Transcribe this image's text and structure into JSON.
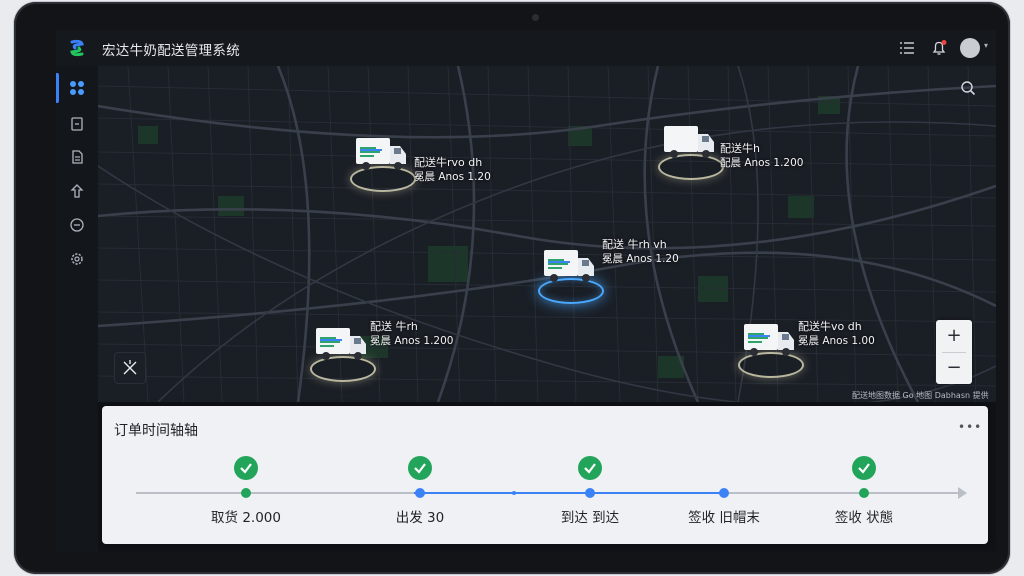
{
  "app": {
    "title": "宏达牛奶配送管理系统"
  },
  "colors": {
    "accent": "#3b82f6",
    "success": "#22a55a",
    "map_bg": "#1a1e25",
    "timeline_bg": "#f0f1f4"
  },
  "header_icons": [
    "list-icon",
    "notification-bell-icon",
    "user-avatar"
  ],
  "sidebar": {
    "items": [
      {
        "icon": "dashboard-icon",
        "active": true
      },
      {
        "icon": "orders-icon"
      },
      {
        "icon": "document-icon"
      },
      {
        "icon": "route-icon"
      },
      {
        "icon": "support-icon"
      },
      {
        "icon": "settings-icon"
      }
    ]
  },
  "map": {
    "credit": "配送地图数据 Go 地图 Dabhasn 提供",
    "zoom_in": "+",
    "zoom_out": "−",
    "trucks": [
      {
        "line1": "配送牛rvo dh",
        "line2": "冕晨 Anos 1.20",
        "active": false
      },
      {
        "line1": "配送牛h",
        "line2": "配晨 Anos 1.200",
        "active": false
      },
      {
        "line1": "配送 牛rh vh",
        "line2": "冕晨 Anos 1.20",
        "active": true
      },
      {
        "line1": "配送 牛rh",
        "line2": "冕晨 Anos 1.200",
        "active": false
      },
      {
        "line1": "配送牛vo dh",
        "line2": "冕晨 Anos 1.00",
        "active": false
      }
    ]
  },
  "timeline": {
    "title": "订单时间轴轴",
    "more": "•••",
    "steps": [
      {
        "label": "取货 2.000",
        "done": true
      },
      {
        "label": "出发 30",
        "done": true
      },
      {
        "label": "到达 到达",
        "done": true
      },
      {
        "label": "签收 旧帽末",
        "done": false
      },
      {
        "label": "签收 状態",
        "done": true
      }
    ]
  }
}
